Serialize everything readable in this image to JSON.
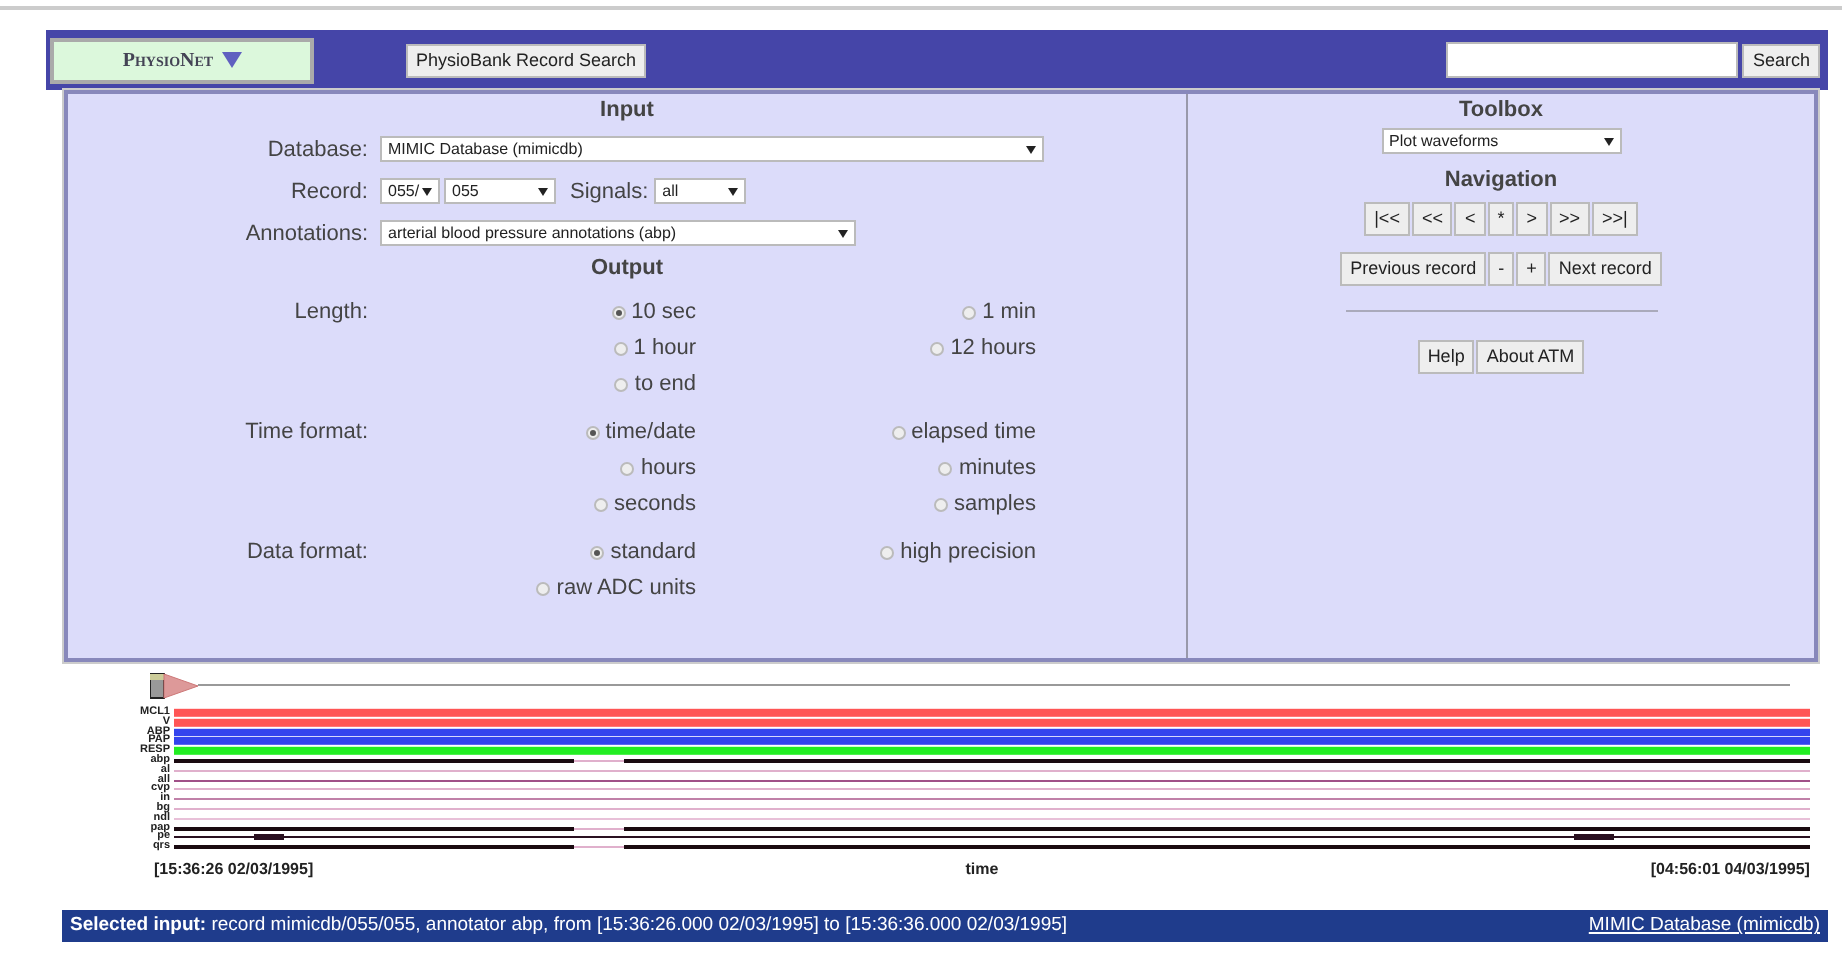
{
  "header": {
    "logo": "PhysioNet",
    "record_search_button": "PhysioBank Record Search",
    "search_button": "Search"
  },
  "input": {
    "heading": "Input",
    "database": {
      "label": "Database:",
      "value": "MIMIC Database (mimicdb)"
    },
    "record": {
      "label": "Record:",
      "directory": "055/",
      "record": "055",
      "signals_label": "Signals:",
      "signals": "all"
    },
    "annotations": {
      "label": "Annotations:",
      "value": "arterial blood pressure annotations (abp)"
    }
  },
  "output": {
    "heading": "Output",
    "groups": [
      {
        "label": "Length:",
        "options": [
          {
            "label": "10 sec",
            "selected": true
          },
          {
            "label": "1 min",
            "selected": false
          },
          {
            "label": "1 hour",
            "selected": false
          },
          {
            "label": "12 hours",
            "selected": false
          },
          {
            "label": "to end",
            "selected": false
          }
        ]
      },
      {
        "label": "Time format:",
        "options": [
          {
            "label": "time/date",
            "selected": true
          },
          {
            "label": "elapsed time",
            "selected": false
          },
          {
            "label": "hours",
            "selected": false
          },
          {
            "label": "minutes",
            "selected": false
          },
          {
            "label": "seconds",
            "selected": false
          },
          {
            "label": "samples",
            "selected": false
          }
        ]
      },
      {
        "label": "Data format:",
        "options": [
          {
            "label": "standard",
            "selected": true
          },
          {
            "label": "high precision",
            "selected": false
          },
          {
            "label": "raw ADC units",
            "selected": false
          }
        ]
      }
    ]
  },
  "toolbox": {
    "heading": "Toolbox",
    "tool": "Plot waveforms",
    "navigation_heading": "Navigation",
    "nav_buttons": [
      "|<<",
      "<<",
      "<",
      "*",
      ">",
      ">>",
      ">>|"
    ],
    "record_buttons": [
      "Previous record",
      "-",
      "+",
      "Next record"
    ],
    "help_buttons": [
      "Help",
      "About ATM"
    ]
  },
  "timeline": {
    "lanes": [
      {
        "label": "MCL1",
        "kind": "signal",
        "color": "#ff5555"
      },
      {
        "label": "V",
        "kind": "signal",
        "color": "#ff5555"
      },
      {
        "label": "ABP",
        "kind": "signal",
        "color": "#3344ee"
      },
      {
        "label": "PAP",
        "kind": "signal",
        "color": "#3344ee"
      },
      {
        "label": "RESP",
        "kind": "signal",
        "color": "#22ee22"
      },
      {
        "label": "abp",
        "kind": "dense",
        "color": "#1a0a10"
      },
      {
        "label": "al",
        "kind": "empty",
        "color": "#e0b0cc"
      },
      {
        "label": "all",
        "kind": "empty",
        "color": "#a05088"
      },
      {
        "label": "cvp",
        "kind": "empty",
        "color": "#e0b0cc"
      },
      {
        "label": "in",
        "kind": "empty",
        "color": "#c080a8"
      },
      {
        "label": "bg",
        "kind": "empty",
        "color": "#e0b0cc"
      },
      {
        "label": "ndl",
        "kind": "empty",
        "color": "#e8c0d8"
      },
      {
        "label": "pap",
        "kind": "dense",
        "color": "#1a0a10"
      },
      {
        "label": "pe",
        "kind": "sparse",
        "color": "#2a1020"
      },
      {
        "label": "qrs",
        "kind": "dense",
        "color": "#1a0a10"
      }
    ],
    "start": "[15:36:26 02/03/1995]",
    "axis_label": "time",
    "end": "[04:56:01 04/03/1995]"
  },
  "status": {
    "text": "**Selected input:** record mimicdb/055/055, annotator abp, from [15:36:26.000 02/03/1995] to [15:36:36.000 02/03/1995]",
    "link": "MIMIC Database (mimicdb)"
  }
}
